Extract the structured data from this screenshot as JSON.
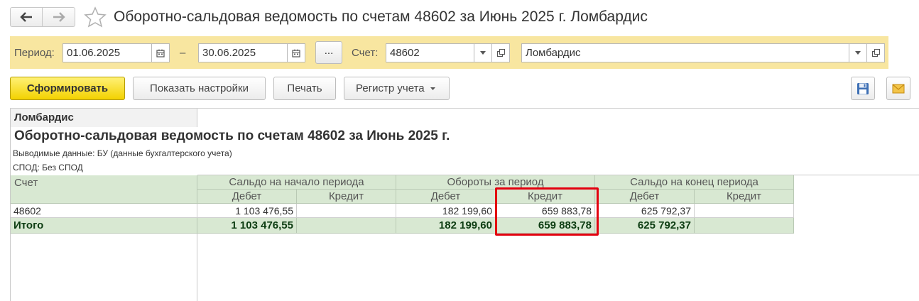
{
  "window": {
    "title": "Оборотно-сальдовая ведомость по счетам 48602 за Июнь 2025 г. Ломбардис",
    "back_icon": "arrow-left-icon",
    "forward_icon": "arrow-right-icon",
    "favorite_icon": "star-icon"
  },
  "filters": {
    "period_label": "Период:",
    "date_from": "01.06.2025",
    "dash": "–",
    "date_to": "30.06.2025",
    "dots_label": "...",
    "account_label": "Счет:",
    "account_value": "48602",
    "organization_value": "Ломбардис"
  },
  "toolbar": {
    "generate_label": "Сформировать",
    "settings_label": "Показать настройки",
    "print_label": "Печать",
    "register_label": "Регистр учета",
    "save_icon": "floppy-disk-icon",
    "mail_icon": "envelope-icon"
  },
  "report": {
    "company": "Ломбардис",
    "title": "Оборотно-сальдовая ведомость по счетам 48602 за Июнь 2025 г.",
    "note_data": "Выводимые данные: БУ (данные бухгалтерского учета)",
    "note_spod": "СПОД: Без СПОД",
    "headers": {
      "account": "Счет",
      "opening": "Сальдо на начало периода",
      "turnover": "Обороты за период",
      "closing": "Сальдо на конец периода",
      "debit": "Дебет",
      "credit": "Кредит"
    },
    "row": {
      "account": "48602",
      "opening_debit": "1 103 476,55",
      "opening_credit": "",
      "turnover_debit": "182 199,60",
      "turnover_credit": "659 883,78",
      "closing_debit": "625 792,37",
      "closing_credit": ""
    },
    "total": {
      "label": "Итого",
      "opening_debit": "1 103 476,55",
      "opening_credit": "",
      "turnover_debit": "182 199,60",
      "turnover_credit": "659 883,78",
      "closing_debit": "625 792,37",
      "closing_credit": ""
    },
    "highlight_color": "#e3000f",
    "header_bg": "#d8e8d2"
  }
}
